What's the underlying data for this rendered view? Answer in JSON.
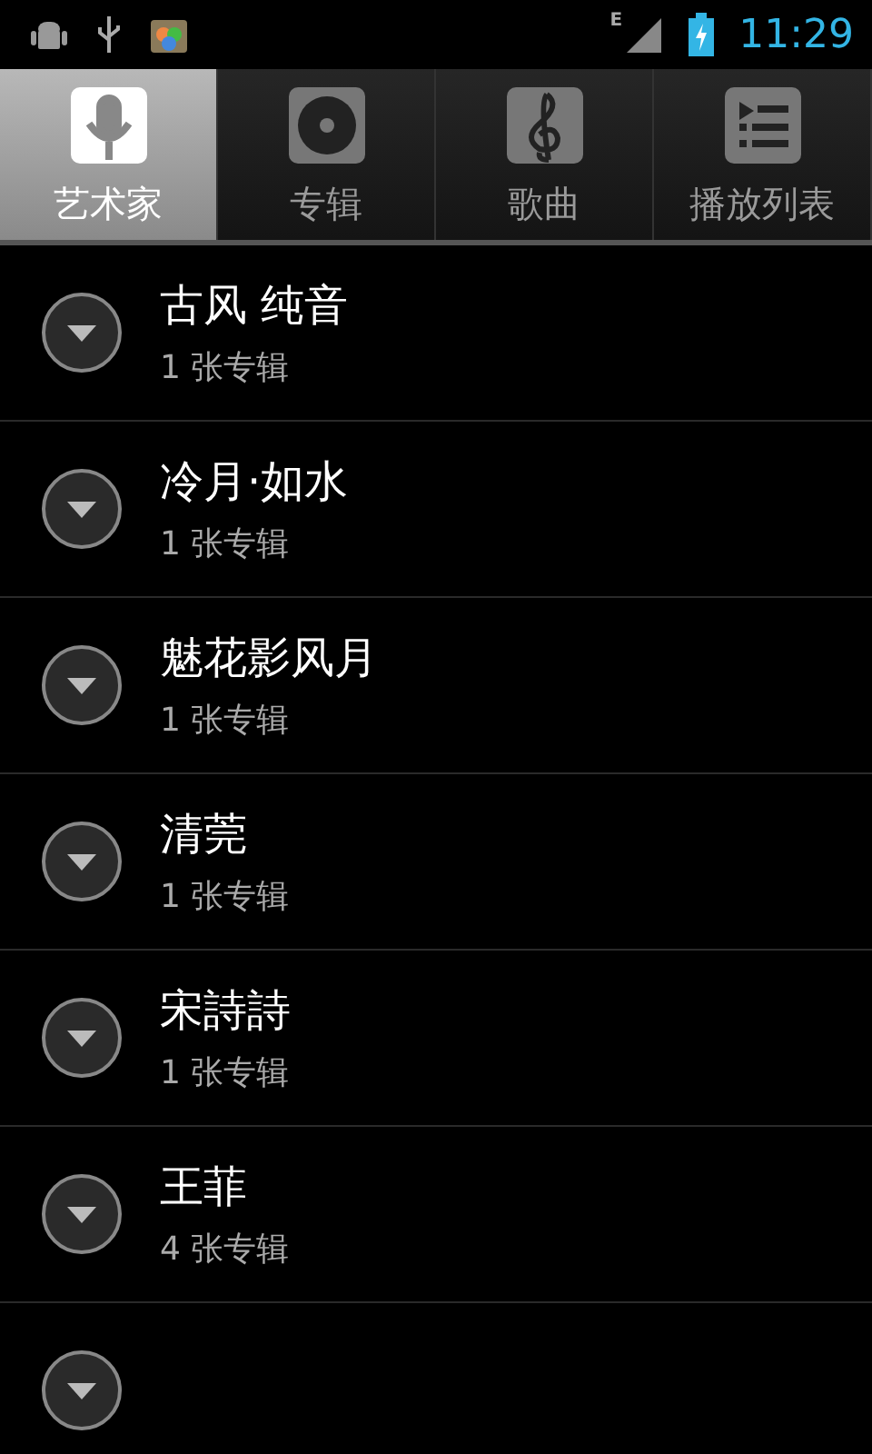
{
  "status_bar": {
    "network": "E",
    "time": "11:29"
  },
  "tabs": [
    {
      "label": "艺术家",
      "kind": "mic",
      "selected": true
    },
    {
      "label": "专辑",
      "kind": "disc",
      "selected": false
    },
    {
      "label": "歌曲",
      "kind": "clef",
      "selected": false
    },
    {
      "label": "播放列表",
      "kind": "list",
      "selected": false
    }
  ],
  "artists": [
    {
      "kind": "artist",
      "name": "古风 纯音",
      "albums": "1 张专辑"
    },
    {
      "kind": "artist",
      "name": "冷月·如水",
      "albums": "1 张专辑"
    },
    {
      "kind": "artist",
      "name": "魅花影风月",
      "albums": "1 张专辑"
    },
    {
      "kind": "artist",
      "name": "清莞",
      "albums": "1 张专辑"
    },
    {
      "kind": "artist",
      "name": "宋詩詩",
      "albums": "1 张专辑"
    },
    {
      "kind": "artist",
      "name": "王菲",
      "albums": "4 张专辑"
    },
    {
      "kind": "covered"
    }
  ]
}
